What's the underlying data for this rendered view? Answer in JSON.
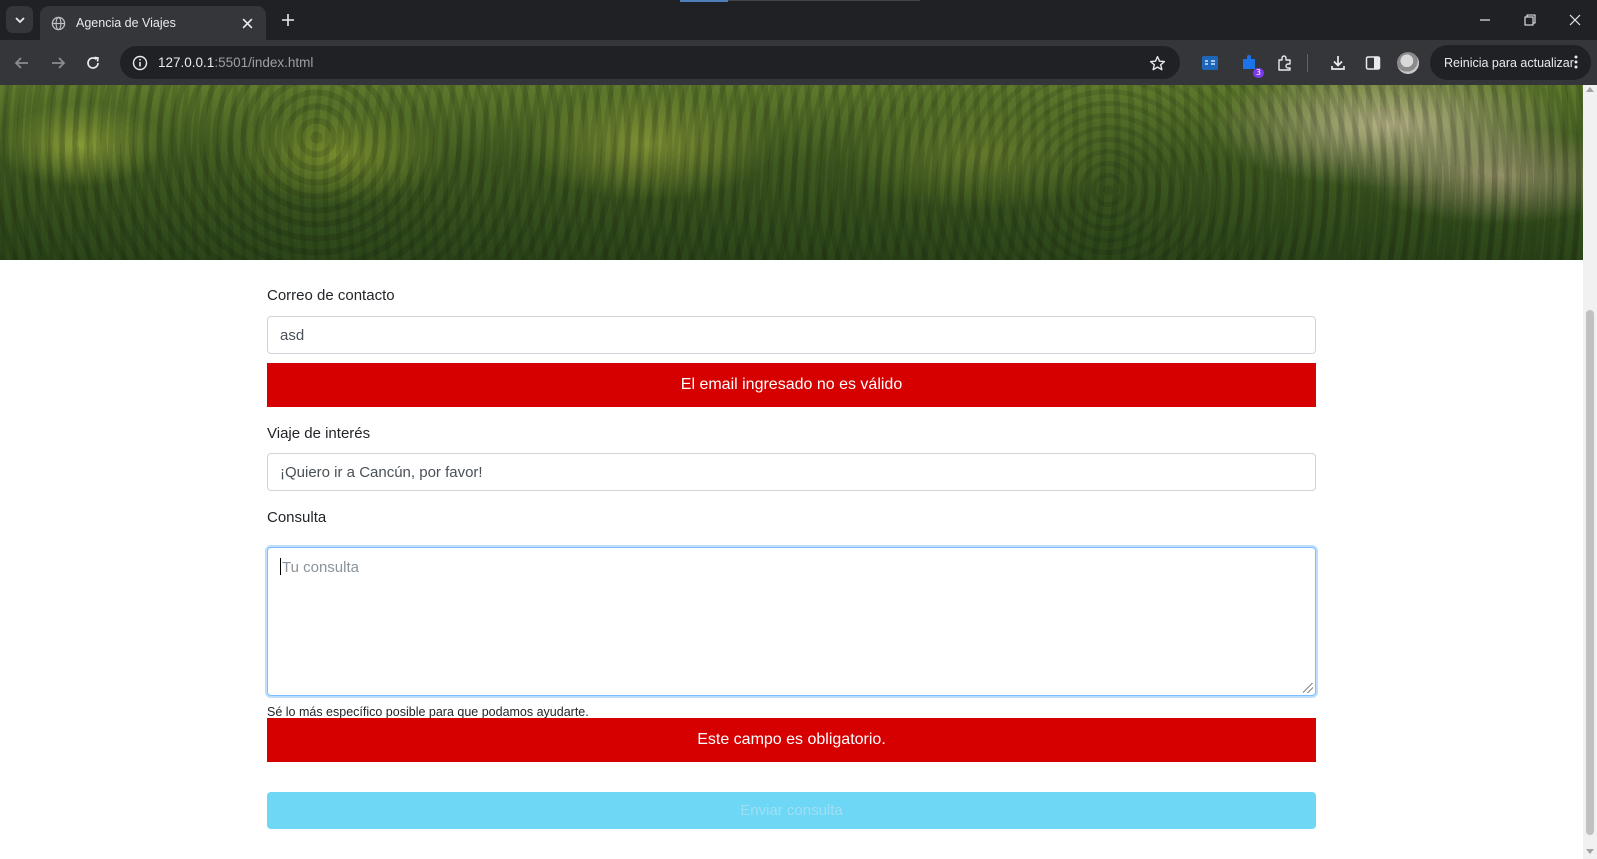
{
  "browser": {
    "tab_title": "Agencia de Viajes",
    "url_host": "127.0.0.1",
    "url_path": ":5501/index.html",
    "update_button": "Reinicia para actualizar",
    "extension_badge": "3"
  },
  "form": {
    "email": {
      "label": "Correo de contacto",
      "value": "asd",
      "error": "El email ingresado no es válido"
    },
    "trip": {
      "label": "Viaje de interés",
      "value": "¡Quiero ir a Cancún, por favor!"
    },
    "query": {
      "label": "Consulta",
      "placeholder": "Tu consulta",
      "help": "Sé lo más específico posible para que podamos ayudarte.",
      "error": "Este campo es obligatorio."
    },
    "submit_label": "Enviar consulta"
  },
  "colors": {
    "error": "#d60000",
    "submit_disabled": "#6dd7f5",
    "browser_frame": "#202124",
    "toolbar": "#35363a"
  },
  "icons": [
    "tab-search-icon",
    "globe-icon",
    "close-icon",
    "plus-icon",
    "minimize-icon",
    "restore-icon",
    "back-icon",
    "forward-icon",
    "reload-icon",
    "site-info-icon",
    "star-icon",
    "extensions-icon",
    "download-icon",
    "side-panel-icon",
    "menu-dots-icon"
  ]
}
